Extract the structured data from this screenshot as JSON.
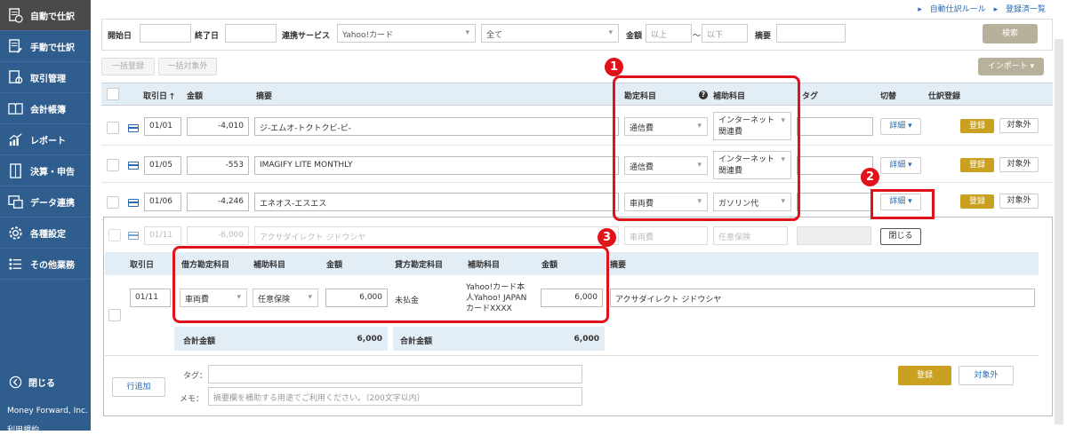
{
  "sidebar": {
    "items": [
      "自動で仕訳",
      "手動で仕訳",
      "取引管理",
      "会計帳簿",
      "レポート",
      "決算・申告",
      "データ連携",
      "各種設定",
      "その他業務"
    ],
    "close": "閉じる",
    "company": "Money Forward, Inc.",
    "terms": "利用規約"
  },
  "toplinks": {
    "rules": "自動仕訳ルール",
    "registered": "登録済一覧"
  },
  "filter": {
    "start_label": "開始日",
    "end_label": "終了日",
    "service_label": "連携サービス",
    "service_value": "Yahoo!カード",
    "all_value": "全て",
    "amount_label": "金額",
    "amount_min_ph": "以上",
    "tilde": "～",
    "amount_max_ph": "以下",
    "memo_label": "摘要",
    "search": "検索"
  },
  "actions": {
    "bulk_register": "一括登録",
    "bulk_exclude": "一括対象外",
    "import": "インポート ▾"
  },
  "table": {
    "headers": {
      "date": "取引日",
      "amount": "金額",
      "memo": "摘要",
      "account": "勘定科目",
      "sub_account": "補助科目",
      "tag": "タグ",
      "switch": "切替",
      "register": "仕訳登録"
    },
    "rows": [
      {
        "date": "01/01",
        "amount": "-4,010",
        "memo": "ジ-エムオ-トクトクビ-ピ-",
        "account": "通信費",
        "sub1": "インターネット",
        "sub2": "関連費"
      },
      {
        "date": "01/05",
        "amount": "-553",
        "memo": "IMAGIFY LITE MONTHLY",
        "account": "通信費",
        "sub1": "インターネット",
        "sub2": "関連費"
      },
      {
        "date": "01/06",
        "amount": "-4,246",
        "memo": "エネオス-エスエス",
        "account": "車両費",
        "sub1": "ガソリン代",
        "sub2": ""
      }
    ],
    "detail_label": "詳細 ▾",
    "register_label": "登録",
    "exclude_label": "対象外"
  },
  "expanded_row": {
    "date": "01/11",
    "amount": "-6,000",
    "memo": "アクサダイレクト ジドウシヤ",
    "account": "車両費",
    "sub": "任意保険",
    "close": "閉じる"
  },
  "split": {
    "headers": {
      "date": "取引日",
      "debit_account": "借方勘定科目",
      "debit_sub": "補助科目",
      "debit_amount": "金額",
      "credit_account": "貸方勘定科目",
      "credit_sub": "補助科目",
      "credit_amount": "金額",
      "memo": "摘要"
    },
    "row": {
      "date": "01/11",
      "debit_account": "車両費",
      "debit_sub": "任意保険",
      "debit_amount": "6,000",
      "credit_account": "未払金",
      "credit_sub_1": "Yahoo!カード本",
      "credit_sub_2": "人Yahoo! JAPAN",
      "credit_sub_3": "カードXXXX",
      "credit_amount": "6,000",
      "memo": "アクサダイレクト ジドウシヤ"
    },
    "sum_label": "合計金額",
    "debit_sum": "6,000",
    "credit_sum": "6,000"
  },
  "bottom": {
    "add_row": "行追加",
    "tag_label": "タグ：",
    "memo_label": "メモ：",
    "memo_placeholder": "摘要欄を補助する用途でご利用ください。（200文字以内）",
    "register": "登録",
    "exclude": "対象外"
  },
  "annotations": {
    "one": "1",
    "two": "2",
    "three": "3"
  },
  "colors": {
    "sidebar": "#2f5d8e",
    "active": "#4a4a4a",
    "gold": "#c9a020",
    "annotation": "#e0131b",
    "header_bg": "#e3edf6"
  }
}
